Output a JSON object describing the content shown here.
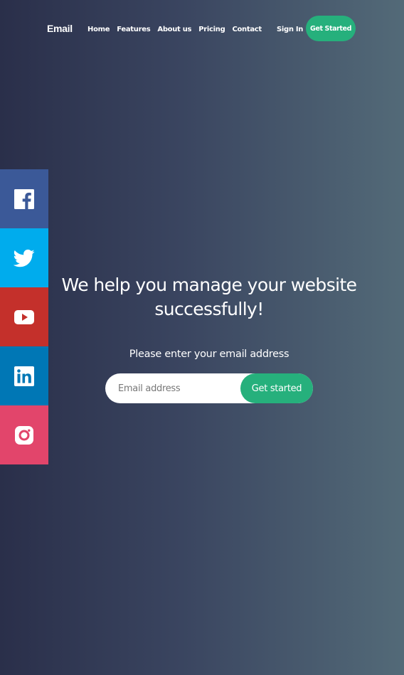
{
  "header": {
    "logo": "Email",
    "nav": [
      "Home",
      "Features",
      "About us",
      "Pricing",
      "Contact"
    ],
    "sign_in": "Sign In",
    "cta": "Get Started"
  },
  "social": [
    {
      "name": "facebook",
      "icon": "facebook-icon",
      "color": "#3b5998"
    },
    {
      "name": "twitter",
      "icon": "twitter-icon",
      "color": "#00aced"
    },
    {
      "name": "youtube",
      "icon": "youtube-icon",
      "color": "#c4302b"
    },
    {
      "name": "linkedin",
      "icon": "linkedin-icon",
      "color": "#0077b5"
    },
    {
      "name": "instagram",
      "icon": "instagram-icon",
      "color": "#e2456b"
    }
  ],
  "hero": {
    "headline": "We help you manage your website successfully!",
    "prompt": "Please enter your email address",
    "email_placeholder": "Email address",
    "email_value": "",
    "submit_label": "Get started"
  },
  "colors": {
    "accent": "#26b07c",
    "gradient_left": "#2a2f4a",
    "gradient_right": "#536a78"
  }
}
